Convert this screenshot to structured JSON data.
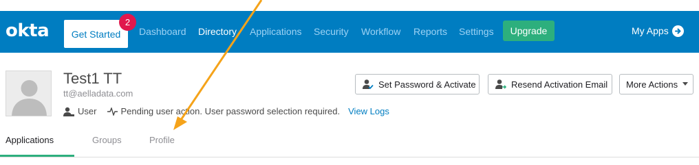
{
  "header": {
    "logo": "okta",
    "get_started_label": "Get Started",
    "notification_count": "2",
    "nav_items": [
      {
        "label": "Dashboard",
        "active": false
      },
      {
        "label": "Directory",
        "active": true
      },
      {
        "label": "Applications",
        "active": false
      },
      {
        "label": "Security",
        "active": false
      },
      {
        "label": "Workflow",
        "active": false
      },
      {
        "label": "Reports",
        "active": false
      },
      {
        "label": "Settings",
        "active": false
      }
    ],
    "upgrade_label": "Upgrade",
    "my_apps_label": "My Apps",
    "my_apps_icon": "arrow-circle-right-icon"
  },
  "user": {
    "name": "Test1 TT",
    "email": "tt@aelladata.com",
    "role": "User",
    "status_text": "Pending user action. User password selection required.",
    "view_logs_label": "View Logs"
  },
  "actions": {
    "set_password_label": "Set Password & Activate",
    "resend_label": "Resend Activation Email",
    "more_label": "More Actions"
  },
  "tabs": [
    {
      "label": "Applications",
      "active": true
    },
    {
      "label": "Groups",
      "active": false
    },
    {
      "label": "Profile",
      "active": false
    }
  ],
  "colors": {
    "brand": "#007dc1",
    "upgrade": "#2daf7d",
    "badge": "#e0184d",
    "annotation_arrow": "#f5a31a"
  }
}
